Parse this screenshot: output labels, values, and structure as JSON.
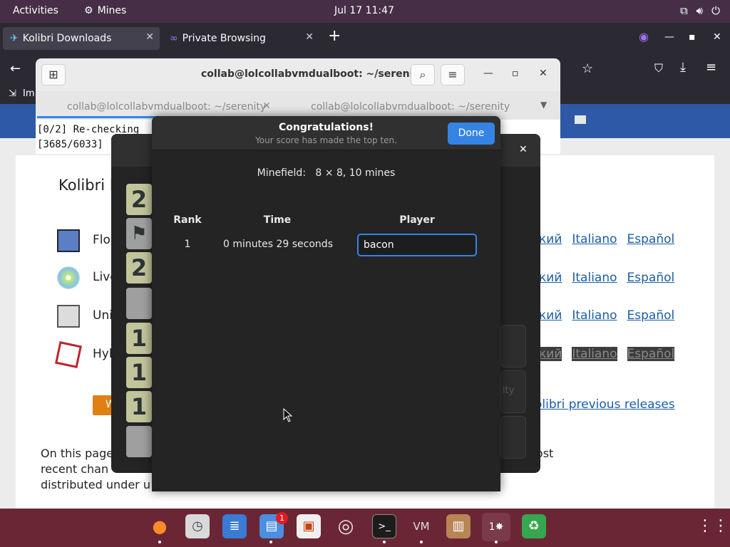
{
  "topbar": {
    "activities": "Activities",
    "app_name": "Mines",
    "clock": "Jul 17  11:47"
  },
  "browser": {
    "tabs": [
      {
        "label": "Kolibri Downloads"
      },
      {
        "label": "Private Browsing"
      }
    ],
    "bookmarks_partial": "Im"
  },
  "terminal": {
    "title": "collab@lolcollabvmdualboot: ~/serenity",
    "tabs": [
      {
        "label": "collab@lolcollabvmdualboot: ~/serenity"
      },
      {
        "label": "collab@lolcollabvmdualboot: ~/serenity"
      }
    ],
    "lines": [
      "[0/2] Re-checking",
      "[3685/6033]"
    ]
  },
  "webpage": {
    "title_partial": "Kolibri I",
    "rows": [
      {
        "label": "Flop",
        "links": [
          "кий",
          "Italiano",
          "Español"
        ]
      },
      {
        "label": "Live",
        "links": [
          "кий",
          "Italiano",
          "Español"
        ]
      },
      {
        "label": "Uni",
        "links": [
          "кий",
          "Italiano",
          "Español"
        ]
      },
      {
        "label": "Hyb",
        "links": [
          "кий",
          "Italiano",
          "Español"
        ]
      }
    ],
    "orange_button_partial": "W",
    "previous_releases": "olibri previous releases",
    "faded_text": "lty",
    "body_lines": [
      "On this page                                                                                y always contain the most",
      "recent chan                                                                              d with 7zip. KolibriOS is",
      "distributed under u                                                                            erver."
    ]
  },
  "mines_board": {
    "cells": [
      "2",
      "flag",
      "2",
      "",
      "1",
      "1",
      "1",
      ""
    ]
  },
  "dialog": {
    "title": "Congratulations!",
    "subtitle": "Your score has made the top ten.",
    "done_label": "Done",
    "minefield_label": "Minefield:",
    "minefield_value": "8 × 8, 10 mines",
    "columns": {
      "rank": "Rank",
      "time": "Time",
      "player": "Player"
    },
    "scores": [
      {
        "rank": "1",
        "time": "0 minutes 29 seconds",
        "player": "bacon"
      }
    ]
  },
  "dock": {
    "notification_badge": "1"
  },
  "colors": {
    "topbar": "#462f46",
    "dock": "#6b2635",
    "accent": "#3584e4",
    "dialog_bg": "#242424",
    "number_cell": "#c2c59a"
  }
}
